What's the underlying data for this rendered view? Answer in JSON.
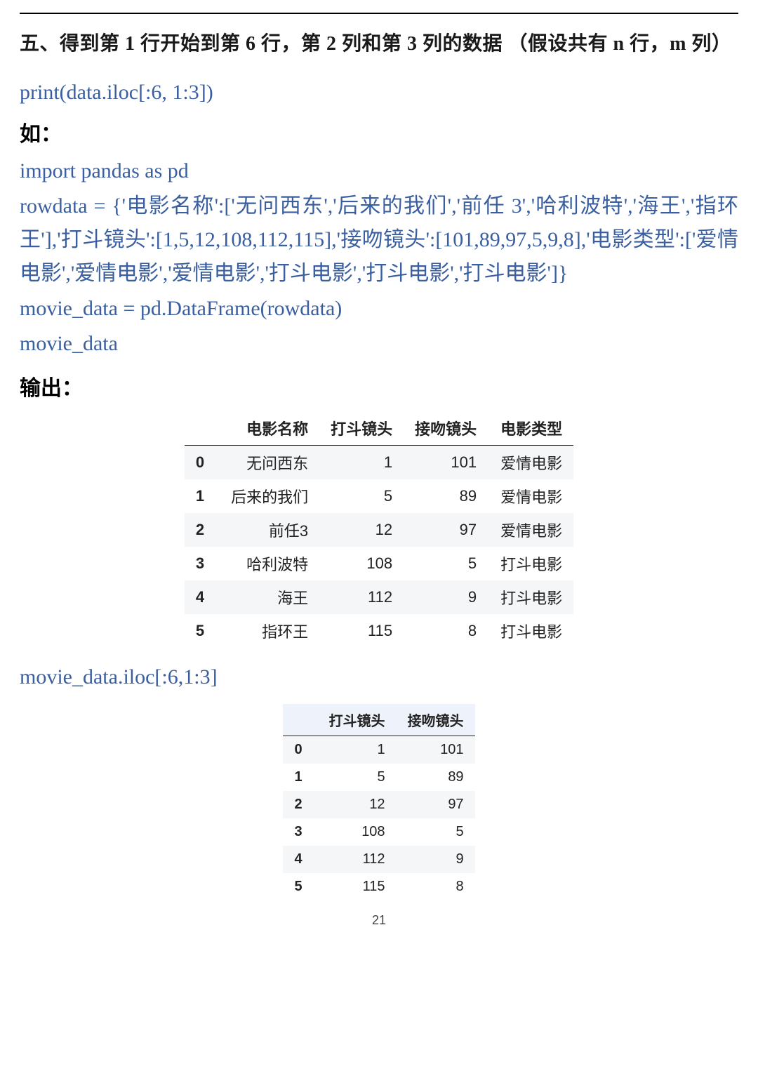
{
  "heading": "五、得到第 1 行开始到第 6 行，第 2 列和第 3 列的数据 （假设共有 n 行，m 列）",
  "code1": "print(data.iloc[:6, 1:3])",
  "label_like": "如：",
  "code2": [
    "import pandas as pd",
    "rowdata = {'电影名称':['无问西东','后来的我们','前任 3','哈利波特','海王','指环王'],'打斗镜头':[1,5,12,108,112,115],'接吻镜头':[101,89,97,5,9,8],'电影类型':['爱情电影','爱情电影','爱情电影','打斗电影','打斗电影','打斗电影']}",
    "movie_data = pd.DataFrame(rowdata)",
    "movie_data"
  ],
  "label_output": "输出：",
  "table1": {
    "columns": [
      "电影名称",
      "打斗镜头",
      "接吻镜头",
      "电影类型"
    ],
    "rows": [
      {
        "idx": "0",
        "name": "无问西东",
        "fight": "1",
        "kiss": "101",
        "type": "爱情电影"
      },
      {
        "idx": "1",
        "name": "后来的我们",
        "fight": "5",
        "kiss": "89",
        "type": "爱情电影"
      },
      {
        "idx": "2",
        "name": "前任3",
        "fight": "12",
        "kiss": "97",
        "type": "爱情电影"
      },
      {
        "idx": "3",
        "name": "哈利波特",
        "fight": "108",
        "kiss": "5",
        "type": "打斗电影"
      },
      {
        "idx": "4",
        "name": "海王",
        "fight": "112",
        "kiss": "9",
        "type": "打斗电影"
      },
      {
        "idx": "5",
        "name": "指环王",
        "fight": "115",
        "kiss": "8",
        "type": "打斗电影"
      }
    ]
  },
  "code3": "movie_data.iloc[:6,1:3]",
  "table2": {
    "columns": [
      "打斗镜头",
      "接吻镜头"
    ],
    "rows": [
      {
        "idx": "0",
        "fight": "1",
        "kiss": "101"
      },
      {
        "idx": "1",
        "fight": "5",
        "kiss": "89"
      },
      {
        "idx": "2",
        "fight": "12",
        "kiss": "97"
      },
      {
        "idx": "3",
        "fight": "108",
        "kiss": "5"
      },
      {
        "idx": "4",
        "fight": "112",
        "kiss": "9"
      },
      {
        "idx": "5",
        "fight": "115",
        "kiss": "8"
      }
    ]
  },
  "page_number": "21"
}
